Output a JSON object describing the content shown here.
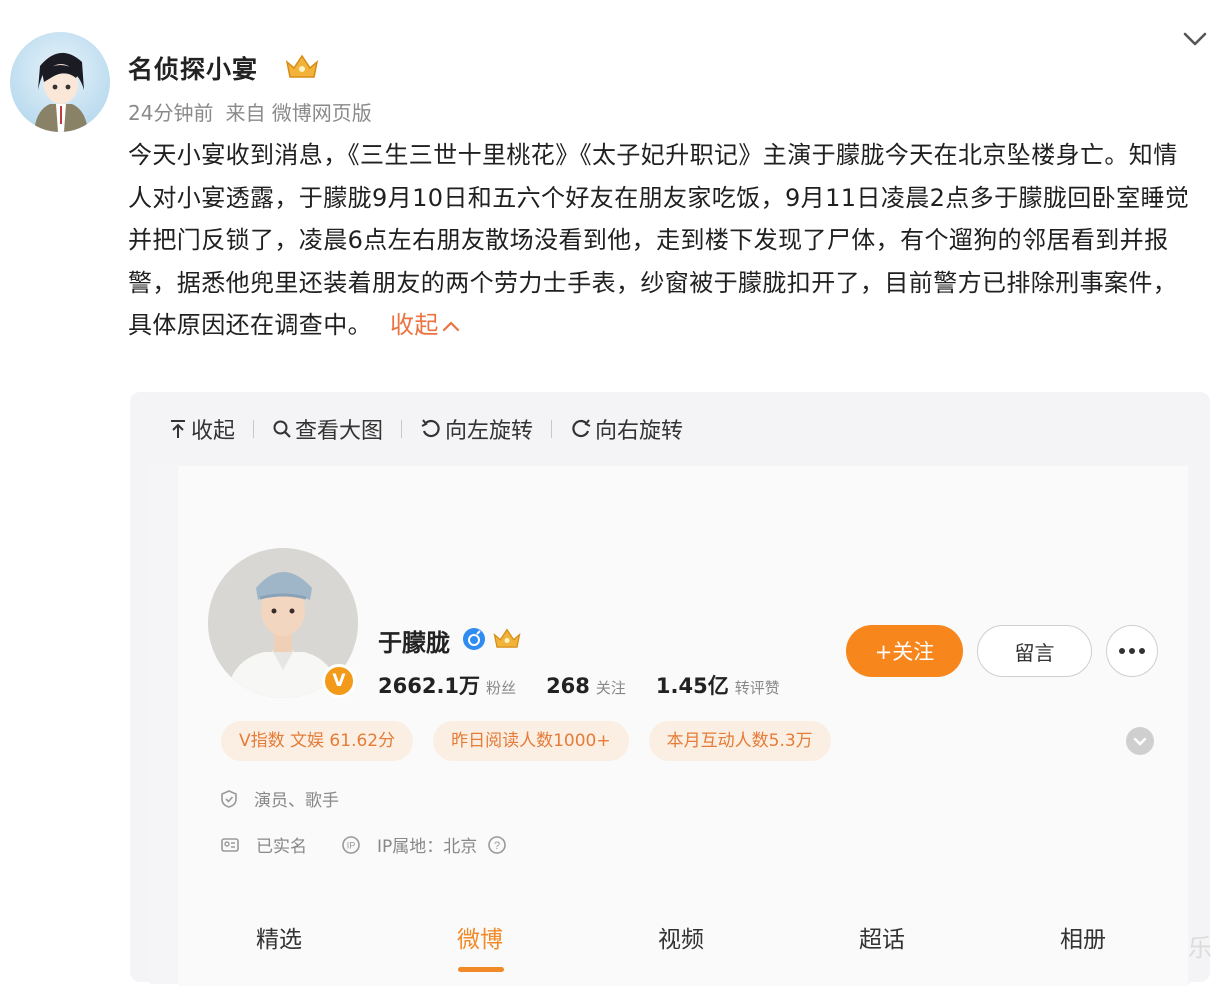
{
  "post": {
    "author": "名侦探小宴",
    "time": "24分钟前",
    "source": "来自 微博网页版",
    "body": "今天小宴收到消息，《三生三世十里桃花》《太子妃升职记》主演于朦胧今天在北京坠楼身亡。知情人对小宴透露，于朦胧9月10日和五六个好友在朋友家吃饭，9月11日凌晨2点多于朦胧回卧室睡觉并把门反锁了，凌晨6点左右朋友散场没看到他，走到楼下发现了尸体，有个遛狗的邻居看到并报警，据悉他兜里还装着朋友的两个劳力士手表，纱窗被于朦胧扣开了，目前警方已排除刑事案件，具体原因还在调查中。",
    "collapse_label": "收起"
  },
  "viewer_toolbar": {
    "collapse": "收起",
    "view_large": "查看大图",
    "rotate_left": "向左旋转",
    "rotate_right": "向右旋转"
  },
  "profile": {
    "name": "于朦胧",
    "badge_letter": "V",
    "stats": [
      {
        "value": "2662.1万",
        "label": "粉丝"
      },
      {
        "value": "268",
        "label": "关注"
      },
      {
        "value": "1.45亿",
        "label": "转评赞"
      }
    ],
    "follow_label": "+关注",
    "message_label": "留言",
    "tags": [
      "V指数 文娱 61.62分",
      "昨日阅读人数1000+",
      "本月互动人数5.3万"
    ],
    "role": "演员、歌手",
    "verified_name": "已实名",
    "ip_location": "IP属地：北京",
    "tabs": [
      "精选",
      "微博",
      "视频",
      "超话",
      "相册"
    ]
  },
  "watermark": "乐",
  "colors": {
    "accent": "#f7861d",
    "link": "#eb7340",
    "tag_bg": "#fbeee2"
  }
}
